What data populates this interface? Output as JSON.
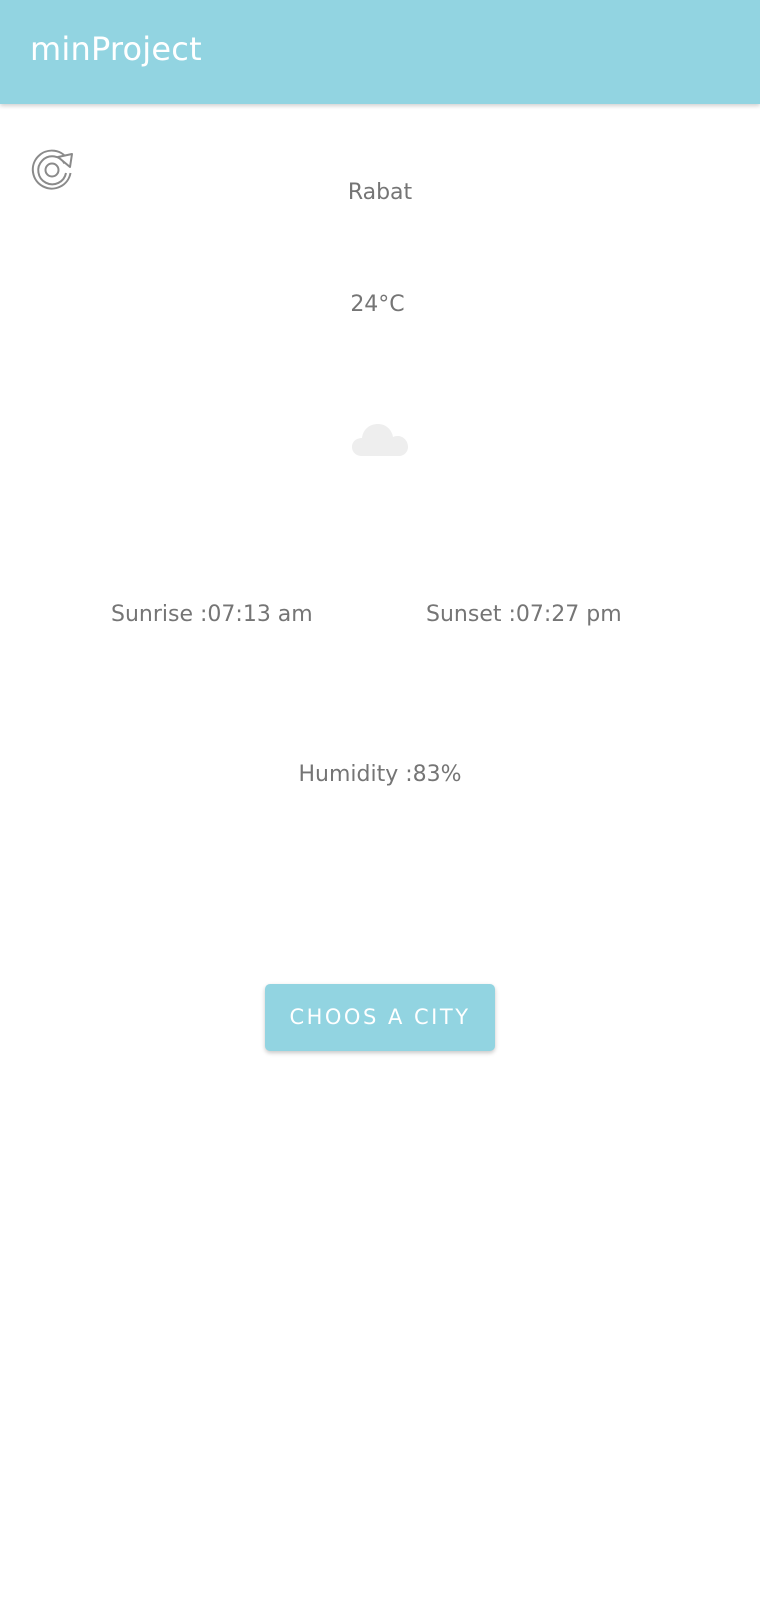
{
  "app_bar": {
    "title": "minProject",
    "color": "#92d4e1"
  },
  "refresh": {
    "icon": "refresh-icon"
  },
  "weather": {
    "city": "Rabat",
    "temperature": "24°C",
    "condition_icon": "cloud-icon",
    "sunrise": "Sunrise :07:13 am",
    "sunset": "Sunset :07:27 pm",
    "humidity": "Humidity :83%"
  },
  "actions": {
    "choose_city_label": "CHOOS A CITY"
  }
}
